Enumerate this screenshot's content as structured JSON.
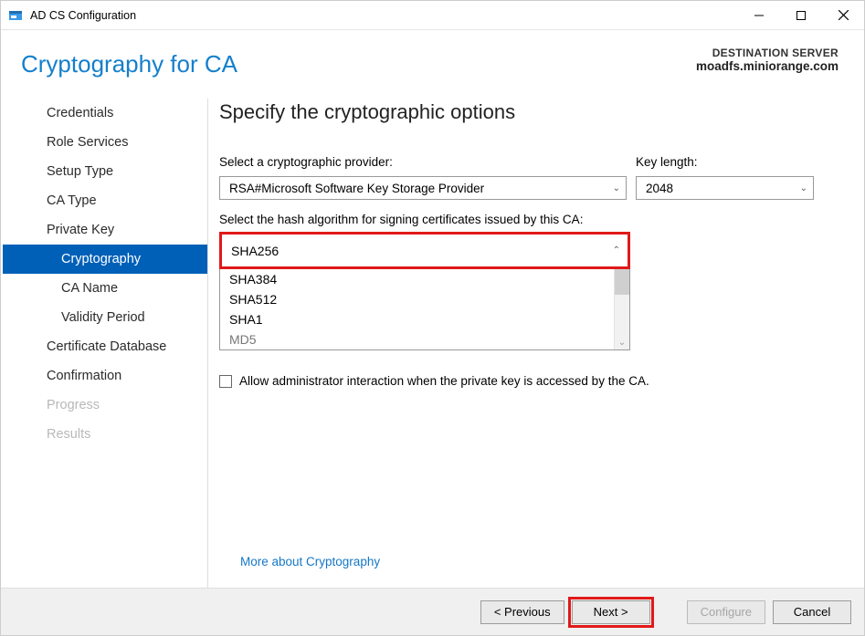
{
  "titlebar": {
    "title": "AD CS Configuration"
  },
  "header": {
    "title": "Cryptography for CA",
    "dest_label": "DESTINATION SERVER",
    "dest_server": "moadfs.miniorange.com"
  },
  "sidebar": {
    "items": [
      {
        "label": "Credentials",
        "level": 0,
        "state": "normal"
      },
      {
        "label": "Role Services",
        "level": 0,
        "state": "normal"
      },
      {
        "label": "Setup Type",
        "level": 0,
        "state": "normal"
      },
      {
        "label": "CA Type",
        "level": 0,
        "state": "normal"
      },
      {
        "label": "Private Key",
        "level": 0,
        "state": "normal"
      },
      {
        "label": "Cryptography",
        "level": 1,
        "state": "active"
      },
      {
        "label": "CA Name",
        "level": 1,
        "state": "normal"
      },
      {
        "label": "Validity Period",
        "level": 1,
        "state": "normal"
      },
      {
        "label": "Certificate Database",
        "level": 0,
        "state": "normal"
      },
      {
        "label": "Confirmation",
        "level": 0,
        "state": "normal"
      },
      {
        "label": "Progress",
        "level": 0,
        "state": "disabled"
      },
      {
        "label": "Results",
        "level": 0,
        "state": "disabled"
      }
    ]
  },
  "main": {
    "heading": "Specify the cryptographic options",
    "provider_label": "Select a cryptographic provider:",
    "provider_value": "RSA#Microsoft Software Key Storage Provider",
    "keylen_label": "Key length:",
    "keylen_value": "2048",
    "hash_label": "Select the hash algorithm for signing certificates issued by this CA:",
    "hash_selected": "SHA256",
    "hash_options": [
      "SHA384",
      "SHA512",
      "SHA1",
      "MD5"
    ],
    "checkbox_label": "Allow administrator interaction when the private key is accessed by the CA.",
    "more_link": "More about Cryptography"
  },
  "footer": {
    "previous": "< Previous",
    "next": "Next >",
    "configure": "Configure",
    "cancel": "Cancel"
  }
}
